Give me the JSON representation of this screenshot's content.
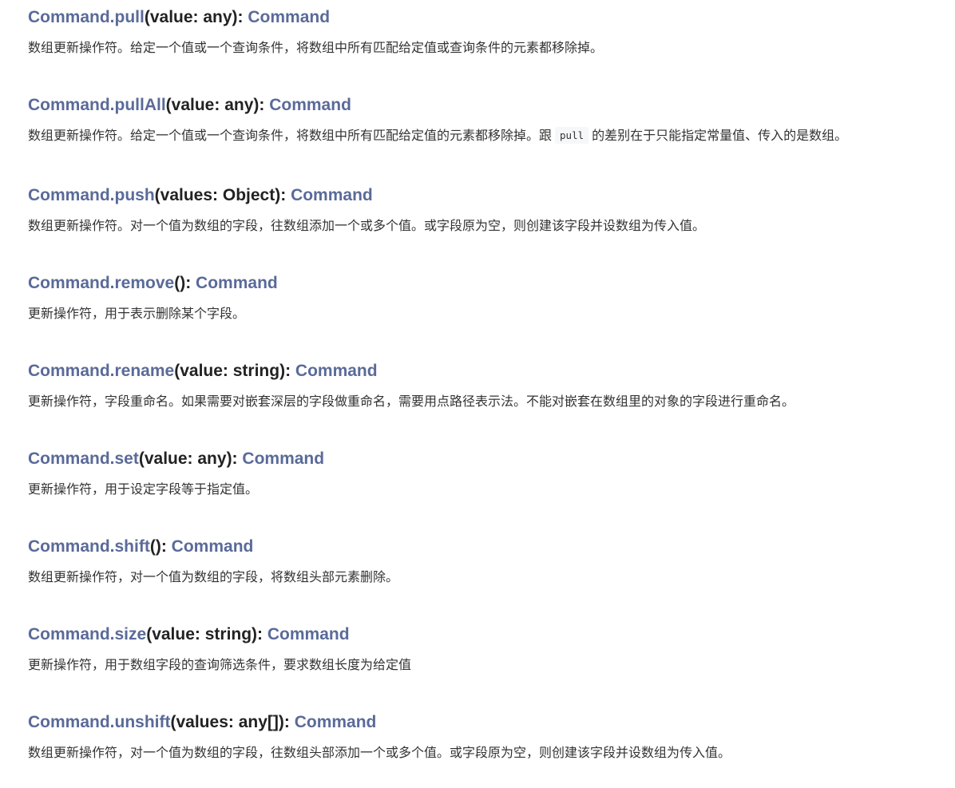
{
  "colors": {
    "accent": "#5a6a99",
    "text": "#222222",
    "body_text": "#333333",
    "code_bg": "#f6f7f8"
  },
  "entries": [
    {
      "name": "Command.pull",
      "params": "(value: any):",
      "returns": "Command",
      "desc": "数组更新操作符。给定一个值或一个查询条件，将数组中所有匹配给定值或查询条件的元素都移除掉。"
    },
    {
      "name": "Command.pullAll",
      "params": "(value: any):",
      "returns": "Command",
      "desc_before": "数组更新操作符。给定一个值或一个查询条件，将数组中所有匹配给定值的元素都移除掉。跟",
      "desc_code": "pull",
      "desc_after": "的差别在于只能指定常量值、传入的是数组。"
    },
    {
      "name": "Command.push",
      "params": "(values: Object):",
      "returns": "Command",
      "desc": "数组更新操作符。对一个值为数组的字段，往数组添加一个或多个值。或字段原为空，则创建该字段并设数组为传入值。"
    },
    {
      "name": "Command.remove",
      "params": "():",
      "returns": "Command",
      "desc": "更新操作符，用于表示删除某个字段。"
    },
    {
      "name": "Command.rename",
      "params": "(value: string):",
      "returns": "Command",
      "desc": "更新操作符，字段重命名。如果需要对嵌套深层的字段做重命名，需要用点路径表示法。不能对嵌套在数组里的对象的字段进行重命名。"
    },
    {
      "name": "Command.set",
      "params": "(value: any):",
      "returns": "Command",
      "desc": "更新操作符，用于设定字段等于指定值。"
    },
    {
      "name": "Command.shift",
      "params": "():",
      "returns": "Command",
      "desc": "数组更新操作符，对一个值为数组的字段，将数组头部元素删除。"
    },
    {
      "name": "Command.size",
      "params": "(value: string):",
      "returns": "Command",
      "desc": "更新操作符，用于数组字段的查询筛选条件，要求数组长度为给定值"
    },
    {
      "name": "Command.unshift",
      "params": "(values: any[]):",
      "returns": "Command",
      "desc": "数组更新操作符，对一个值为数组的字段，往数组头部添加一个或多个值。或字段原为空，则创建该字段并设数组为传入值。"
    }
  ]
}
